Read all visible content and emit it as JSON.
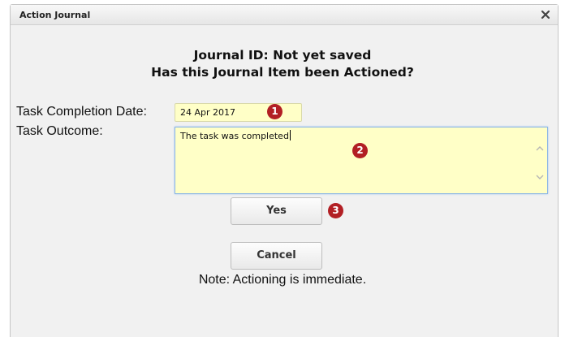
{
  "dialog": {
    "title": "Action Journal",
    "close_icon": "close-icon"
  },
  "heading": {
    "line1": "Journal ID: Not yet saved",
    "line2": "Has this Journal Item been Actioned?"
  },
  "form": {
    "completion_date_label": "Task Completion Date:",
    "completion_date_value": "24 Apr 2017",
    "outcome_label": "Task Outcome:",
    "outcome_value": "The task was completed"
  },
  "buttons": {
    "yes_label": "Yes",
    "cancel_label": "Cancel"
  },
  "note": "Note: Actioning is immediate.",
  "callouts": [
    "1",
    "2",
    "3"
  ],
  "colors": {
    "input_background": "#ffffc7",
    "callout": "#b21f24",
    "focus_border": "#8ab5e6"
  }
}
